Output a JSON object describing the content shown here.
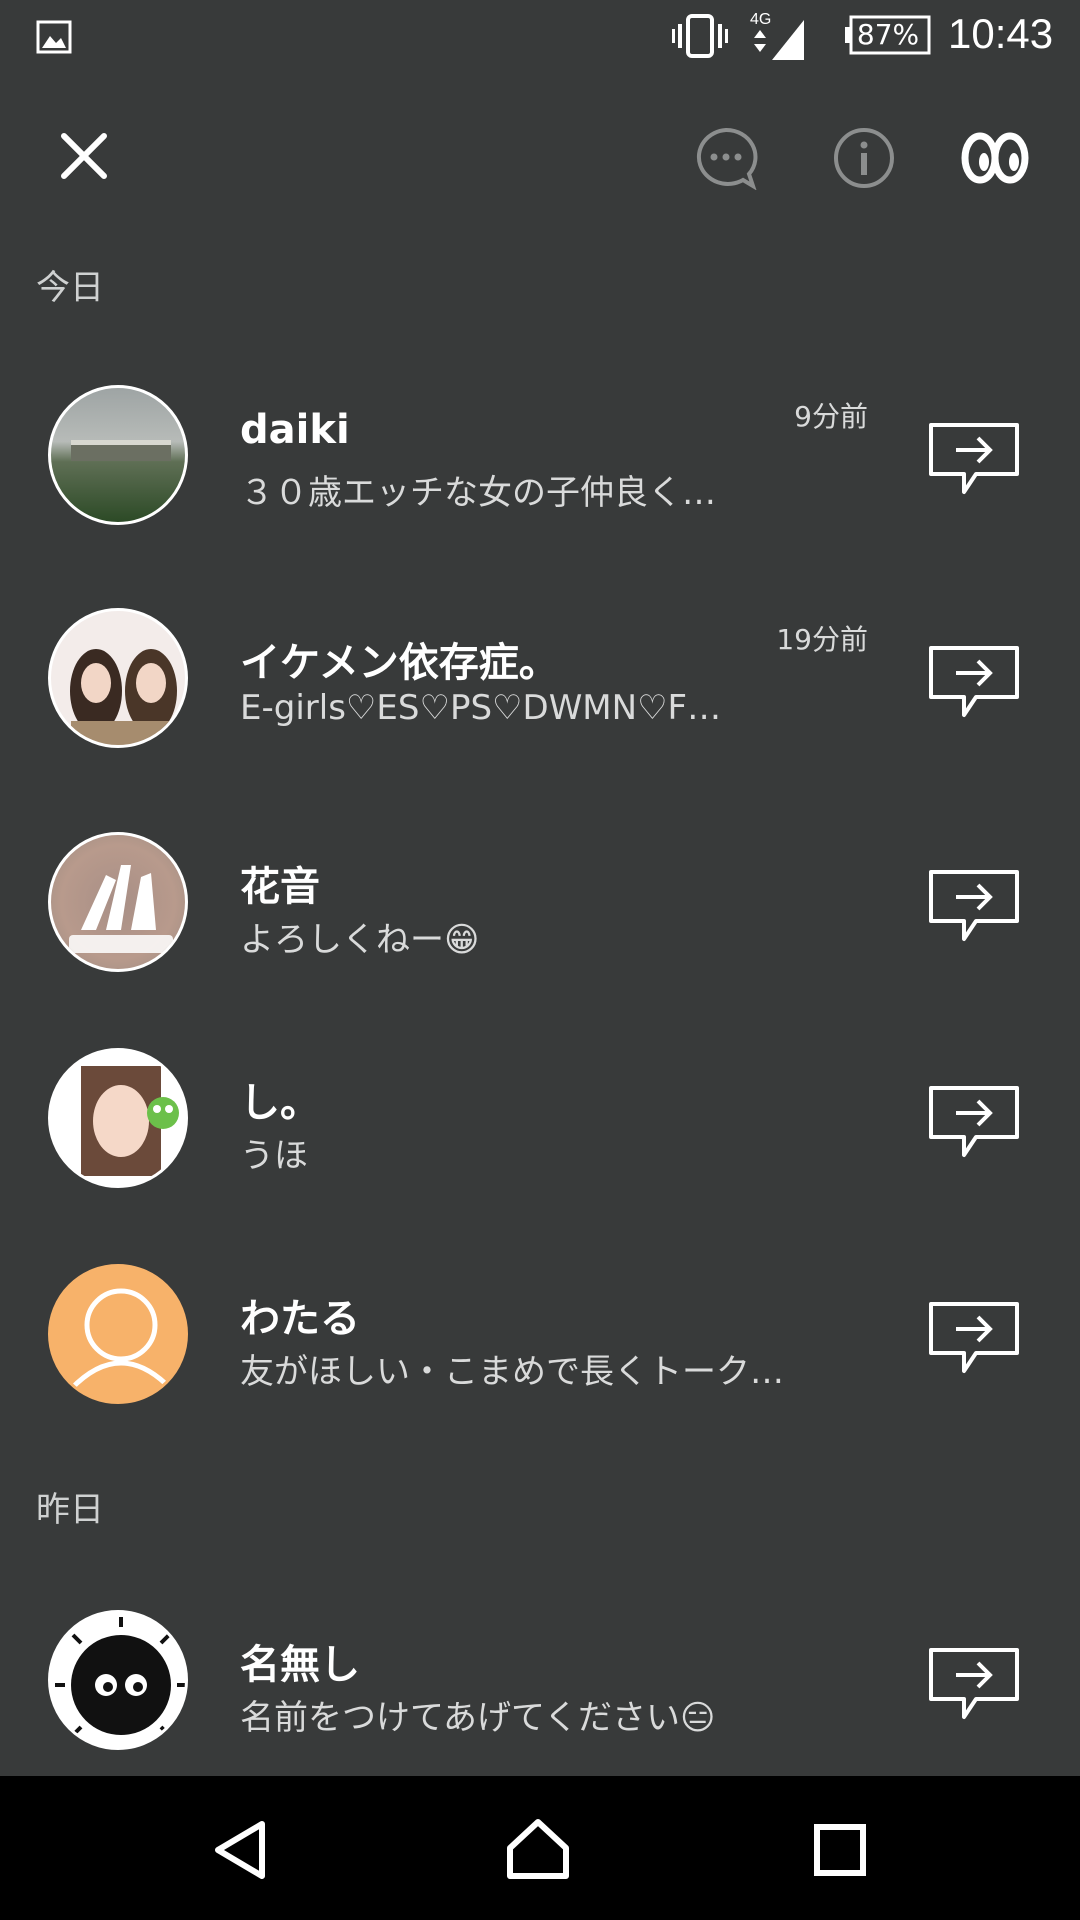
{
  "status_bar": {
    "battery": "87%",
    "network": "4G",
    "time": "10:43",
    "icons": [
      "image-icon",
      "vibrate-icon",
      "signal-icon",
      "battery-icon"
    ]
  },
  "top_bar": {
    "icons": [
      "close-icon",
      "chat-bubble-icon",
      "info-icon",
      "eyes-icon"
    ]
  },
  "sections": {
    "today": "今日",
    "yesterday": "昨日"
  },
  "conversations": [
    {
      "name": "daiki",
      "message": "３０歳エッチな女の子仲良く…",
      "time": "9分前"
    },
    {
      "name": "イケメン依存症。",
      "message": "E-girls♡ES♡PS♡DWMN♡F…",
      "time": "19分前"
    },
    {
      "name": "花音",
      "message": "よろしくねー😁",
      "time": ""
    },
    {
      "name": "し。",
      "message": "うほ",
      "time": ""
    },
    {
      "name": "わたる",
      "message": "友がほしい・こまめで長くトーク…",
      "time": ""
    },
    {
      "name": "名無し",
      "message": "名前をつけてあげてください😑",
      "time": ""
    }
  ],
  "colors": {
    "background": "#383a3a",
    "navbar": "#000000",
    "default_avatar": "#f7b26a"
  }
}
